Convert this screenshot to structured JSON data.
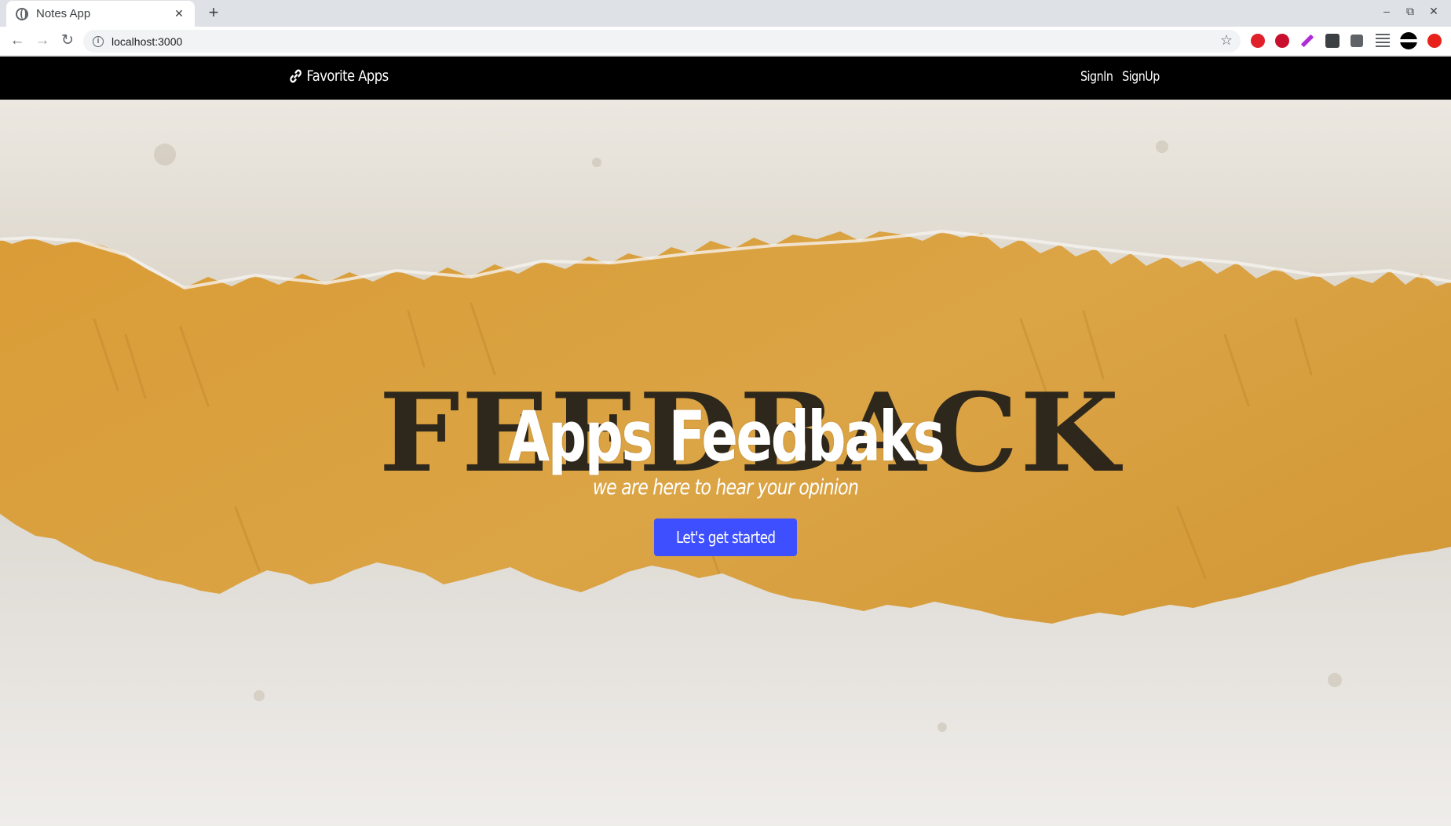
{
  "browser": {
    "tab_title": "Notes App",
    "tab_close": "✕",
    "new_tab": "+",
    "url": "localhost:3000",
    "window_controls": [
      "–",
      "⧉",
      "✕"
    ],
    "extension_icons": [
      "eab-icon",
      "abp-icon",
      "pen-icon",
      "dots-icon",
      "puzzle-icon",
      "queue-icon",
      "profile-icon",
      "red-extension-icon"
    ]
  },
  "navbar": {
    "brand": "Favorite Apps",
    "brand_icon": "link-icon",
    "links": [
      "SignIn",
      "SignUp"
    ]
  },
  "hero": {
    "title": "Apps Feedbaks",
    "subtitle": "we are here to hear your opinion",
    "cta_label": "Let's get started",
    "background_word": "FEEDBACK",
    "background_image": "torn-paper-feedback-image",
    "colors": {
      "cta": "#3d4fff",
      "paper": "#e7e3dc",
      "kraft": "#d99a33",
      "text_light": "#ffffff"
    }
  }
}
